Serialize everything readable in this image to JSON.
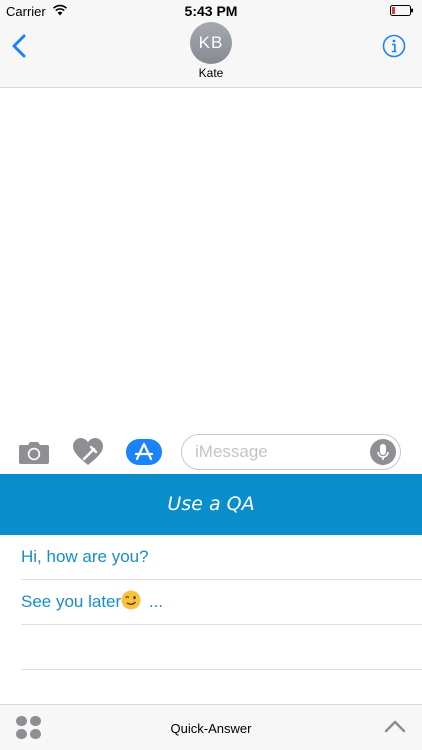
{
  "status": {
    "carrier": "Carrier",
    "time": "5:43 PM"
  },
  "header": {
    "avatar_initials": "KB",
    "contact_name": "Kate"
  },
  "compose": {
    "placeholder": "iMessage"
  },
  "qa": {
    "title": "Use a QA",
    "items": [
      "Hi, how are you?",
      "See you later",
      " ...",
      ""
    ]
  },
  "bottom_bar": {
    "title": "Quick-Answer"
  },
  "colors": {
    "accent": "#1a82fb",
    "qa_header": "#0a8dcb",
    "qa_text": "#168fc4"
  },
  "icons": [
    "wifi-icon",
    "battery-icon",
    "back-chevron-icon",
    "info-icon",
    "camera-icon",
    "digital-touch-heart-icon",
    "app-store-icon",
    "microphone-icon",
    "wink-emoji-icon",
    "apps-grid-icon",
    "chevron-up-icon"
  ]
}
